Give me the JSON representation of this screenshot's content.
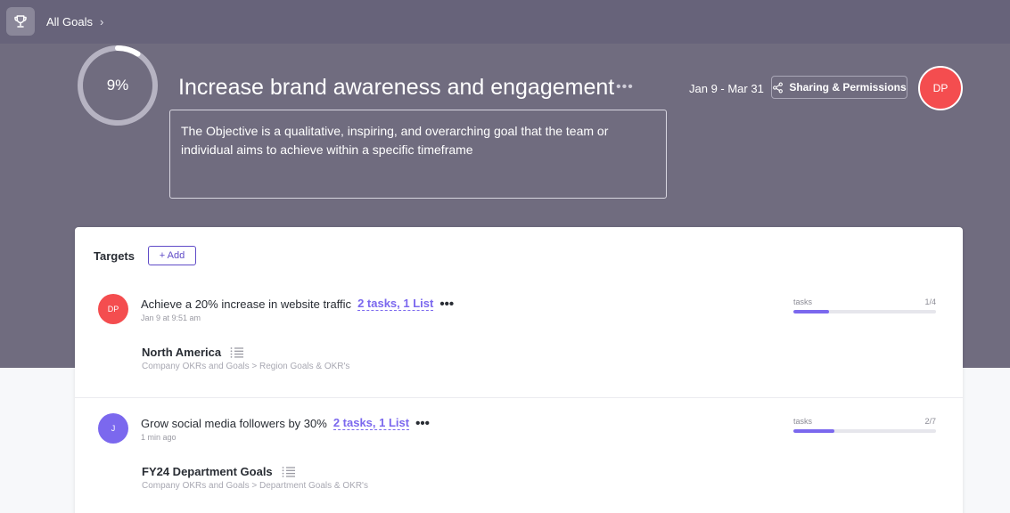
{
  "header": {
    "breadcrumb_label": "All Goals",
    "breadcrumb_chevron": "›"
  },
  "goal": {
    "progress_label": "9%",
    "progress_fraction": 0.09,
    "title": "Increase brand awareness and engagement",
    "more_label": "•••",
    "description": "The Objective is a qualitative, inspiring, and overarching goal that the team or individual aims to achieve within a specific timeframe",
    "dates": "Jan 9 - Mar 31",
    "share_label": "Sharing & Permissions",
    "owner_initials": "DP"
  },
  "targets": {
    "heading": "Targets",
    "add_label": "+ Add",
    "items": [
      {
        "avatar_initials": "DP",
        "avatar_color": "#f44d4f",
        "name": "Achieve a 20% increase in website traffic",
        "link": "2 tasks, 1 List",
        "dots": "•••",
        "time": "Jan 9 at 9:51 am",
        "progress_label": "tasks",
        "progress_count": "1/4",
        "progress_fraction": 0.25,
        "list_name": "North America",
        "list_path": "Company OKRs and Goals > Region Goals & OKR's"
      },
      {
        "avatar_initials": "J",
        "avatar_color": "#7b68ee",
        "name": "Grow social media followers by 30%",
        "link": "2 tasks, 1 List",
        "dots": "•••",
        "time": "1 min ago",
        "progress_label": "tasks",
        "progress_count": "2/7",
        "progress_fraction": 0.2857,
        "list_name": "FY24 Department Goals",
        "list_path": "Company OKRs and Goals > Department Goals & OKR's"
      }
    ]
  },
  "colors": {
    "hero_bg": "#706c7f",
    "accent": "#7b68ee",
    "owner_avatar": "#f44d4f"
  },
  "icons": [
    "trophy-icon",
    "share-icon",
    "list-icon"
  ]
}
